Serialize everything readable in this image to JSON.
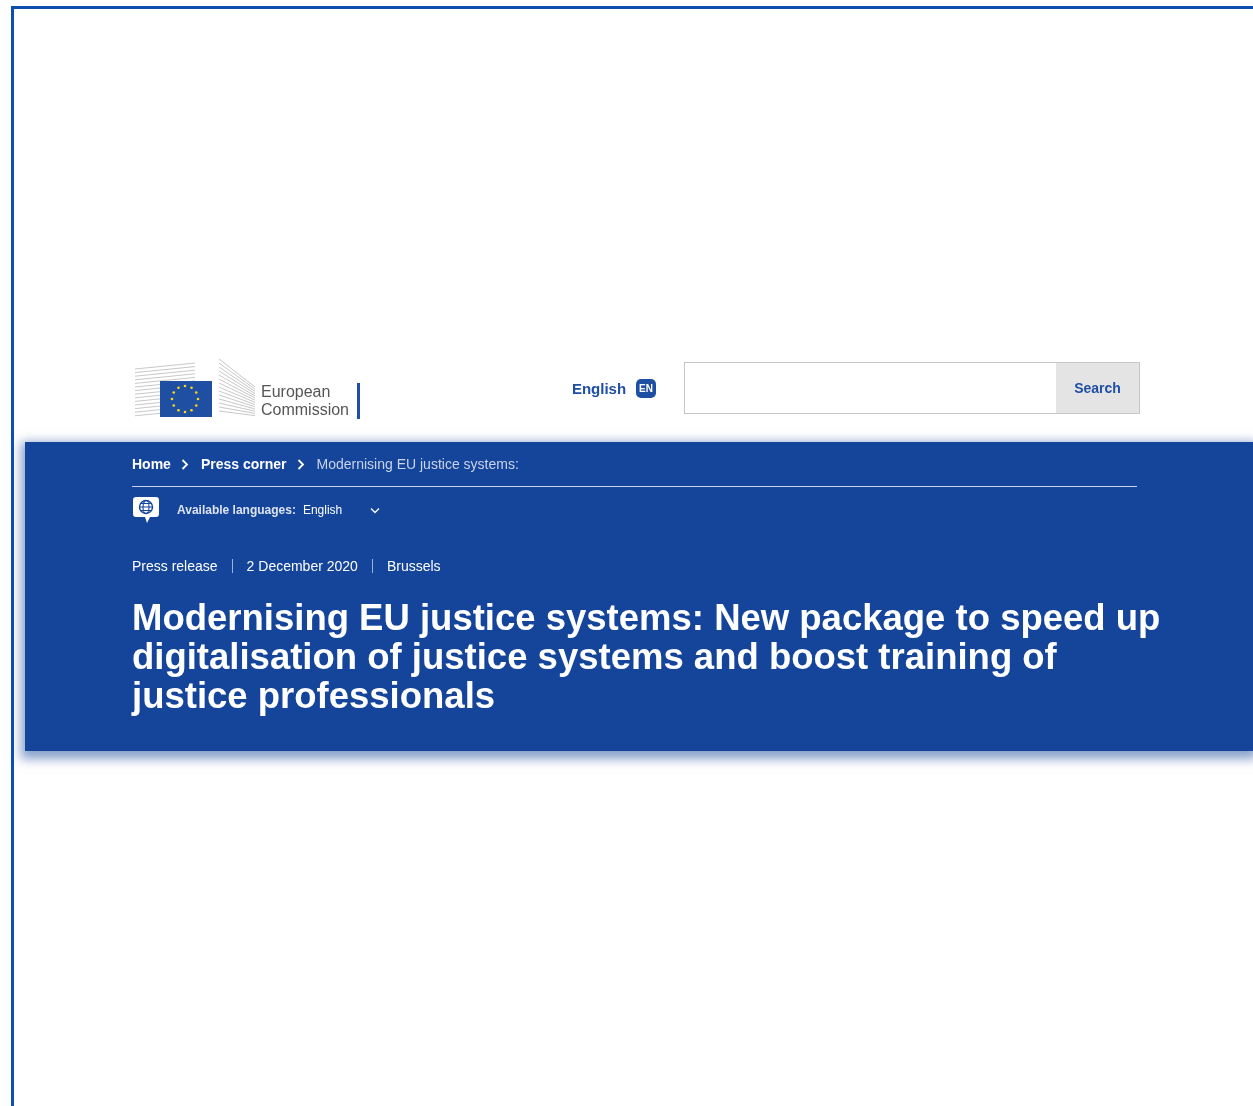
{
  "header": {
    "logo_text": [
      "European",
      "Commission"
    ],
    "language": {
      "label": "English",
      "code": "EN"
    },
    "search": {
      "button": "Search"
    }
  },
  "breadcrumb": [
    {
      "label": "Home",
      "current": false
    },
    {
      "label": "Press corner",
      "current": false
    },
    {
      "label": "Modernising EU justice systems:",
      "current": true
    }
  ],
  "available_languages": {
    "label": "Available languages:",
    "value": "English"
  },
  "meta": [
    "Press release",
    "2 December 2020",
    "Brussels"
  ],
  "title": "Modernising EU justice systems: New package to speed up digitalisation of justice systems and boost training of justice professionals"
}
